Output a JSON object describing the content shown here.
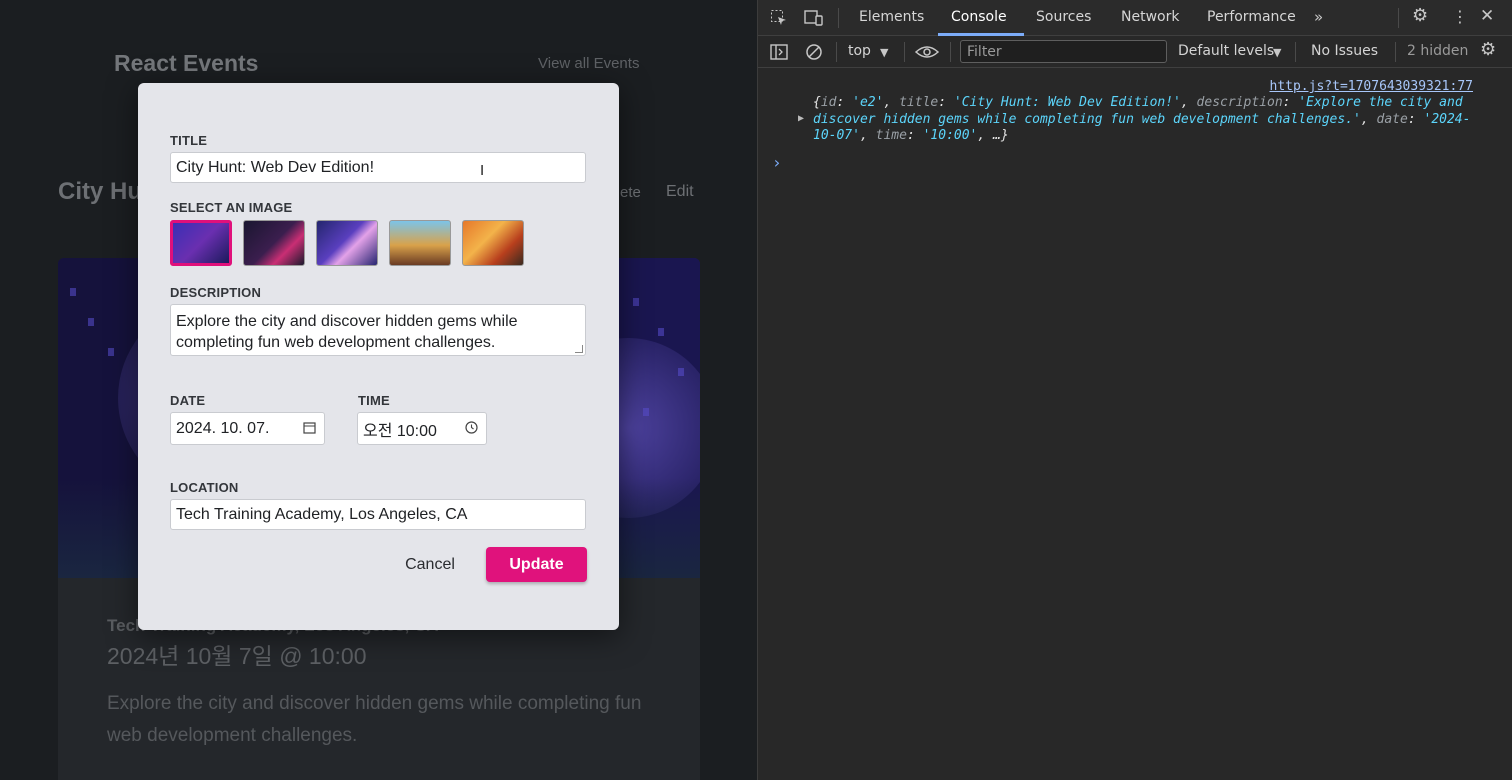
{
  "app": {
    "brand": "React Events",
    "view_all": "View all Events",
    "page_title": "City Hu",
    "actions": {
      "delete": "ete",
      "edit": "Edit"
    },
    "card": {
      "location": "Tech Training Academy, Los Angeles, CA",
      "datetime": "2024년 10월 7일 @ 10:00",
      "description": "Explore the city and discover hidden gems while completing fun web development challenges."
    }
  },
  "modal": {
    "title_label": "TITLE",
    "title_value": "City Hunt: Web Dev Edition!",
    "image_label": "SELECT AN IMAGE",
    "images": [
      {
        "name": "neon-city-street",
        "selected": true
      },
      {
        "name": "neon-laptop-desk",
        "selected": false
      },
      {
        "name": "purple-event-crowd",
        "selected": false
      },
      {
        "name": "autumn-city-skyline",
        "selected": false
      },
      {
        "name": "women-at-cafe",
        "selected": false
      }
    ],
    "description_label": "DESCRIPTION",
    "description_value": "Explore the city and discover hidden gems while completing fun web development challenges.",
    "date_label": "DATE",
    "date_value": "2024. 10. 07.",
    "time_label": "TIME",
    "time_value": "오전 10:00",
    "location_label": "LOCATION",
    "location_value": "Tech Training Academy, Los Angeles, CA",
    "cancel_label": "Cancel",
    "update_label": "Update",
    "accent_color": "#e0127c"
  },
  "devtools": {
    "tabs": [
      "Elements",
      "Console",
      "Sources",
      "Network",
      "Performance"
    ],
    "active_tab": "Console",
    "context": "top",
    "filter_placeholder": "Filter",
    "levels": "Default levels",
    "issues": "No Issues",
    "hidden": "2 hidden",
    "source_link": "http.js?t=1707643039321:77",
    "log": {
      "open": "{",
      "id_key": "id",
      "id_val": "'e2'",
      "title_key": "title",
      "title_val": "'City Hunt: Web Dev Edition!'",
      "desc_key": "description",
      "desc_val": "'Explore the city and discover hidden gems while completing fun web development challenges.'",
      "date_key": "date",
      "date_val": "'2024-10-07'",
      "time_key": "time",
      "time_val": "'10:00'",
      "rest": "…}"
    }
  }
}
